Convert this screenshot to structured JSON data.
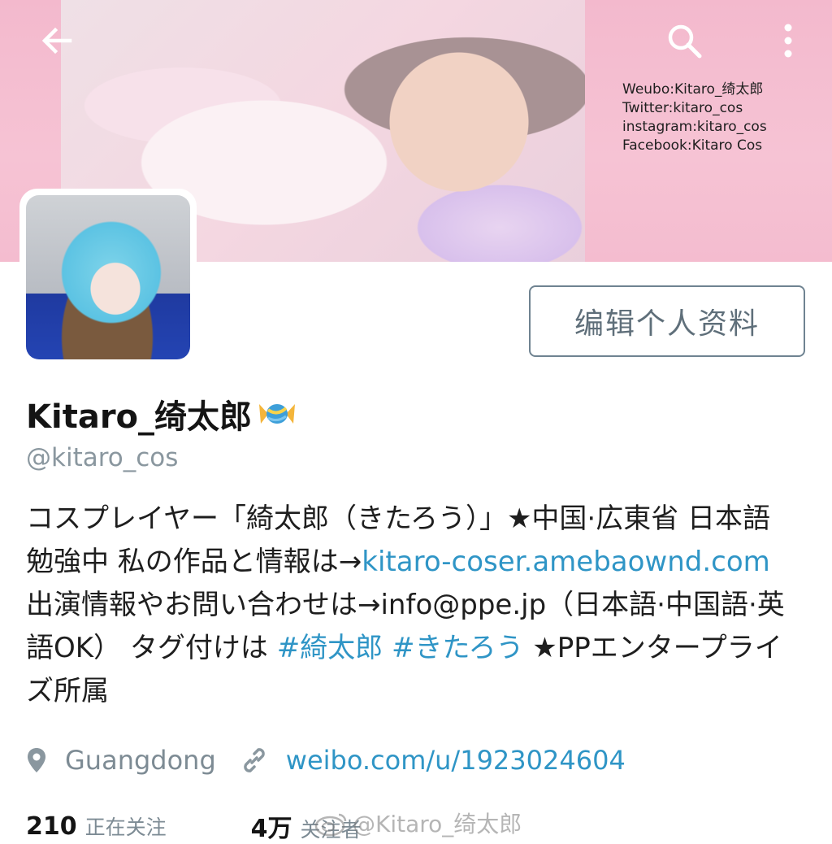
{
  "banner": {
    "socials": [
      "Weubo:Kitaro_绮太郎",
      "Twitter:kitaro_cos",
      "instagram:kitaro_cos",
      "Facebook:Kitaro Cos"
    ]
  },
  "toolbar": {
    "back_icon": "arrow-left-icon",
    "search_icon": "search-icon",
    "more_icon": "more-vertical-icon"
  },
  "profile": {
    "edit_button_label": "编辑个人资料",
    "display_name": "Kitaro_绮太郎",
    "name_emoji": "candy-icon",
    "handle": "@kitaro_cos",
    "bio": {
      "part1": "コスプレイヤー「綺太郎（きたろう）」★中国·広東省 日本語勉強中 私の作品と情報は→",
      "link1": "kitaro-coser.amebaownd.com",
      "part2": " 出演情報やお問い合わせは→info@ppe.jp（日本語·中国語·英語OK） タグ付けは ",
      "tag1": "#綺太郎",
      "sep": " ",
      "tag2": "#きたろう",
      "part3": " ★PPエンタープライズ所属"
    },
    "location": "Guangdong",
    "website": "weibo.com/u/1923024604",
    "following_count": "210",
    "following_label": "正在关注",
    "followers_count": "4万",
    "followers_label": "关注者"
  },
  "watermark": {
    "text": "@Kitaro_绮太郎"
  },
  "colors": {
    "link": "#2f95c6",
    "banner_pink": "#f6c3d4",
    "muted_text": "#7d8b94"
  }
}
